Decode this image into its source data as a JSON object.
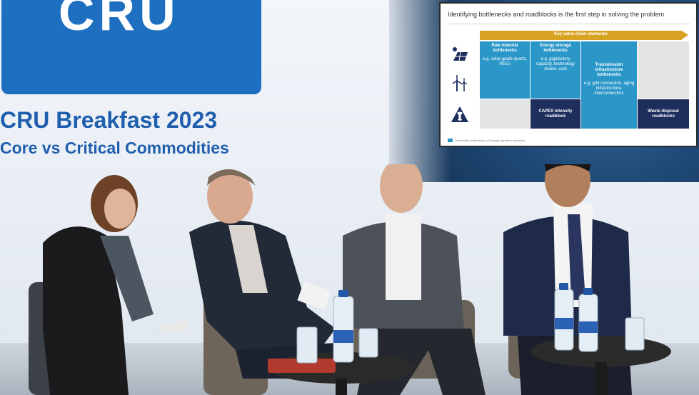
{
  "backdrop": {
    "logo_text": "CRU",
    "event_title": "CRU Breakfast 2023",
    "event_subtitle": "Core vs Critical Commodities"
  },
  "slide": {
    "title": "Identifying bottlenecks and roadblocks is the first step in solving the problem",
    "arrow_label": "Key value chain obstacles",
    "columns": [
      {
        "heading": "Raw material bottlenecks",
        "body": "e.g. solar-grade quartz, REEs"
      },
      {
        "heading": "Energy storage bottlenecks",
        "body": "e.g. gigafactory capacity, technology choice, cost"
      },
      {
        "heading": "Transmission infrastructure bottlenecks",
        "body": "e.g. grid connection, aging infrastructure, interconnectors"
      }
    ],
    "roadblocks": [
      {
        "label": "CAPEX intensity roadblock"
      },
      {
        "label": "Waste disposal roadblocks"
      }
    ],
    "row_icons": [
      "solar-panel-icon",
      "wind-turbine-icon",
      "nuclear-icon"
    ],
    "footer": "Commodity bottlenecks in 3 energy transition scenarios",
    "colors": {
      "accent": "#2b97c9",
      "arrow": "#d8a323",
      "dark": "#1e2f5e"
    }
  },
  "scene": {
    "panelists": [
      "moderator",
      "panelist-2",
      "panelist-3",
      "panelist-4"
    ]
  }
}
